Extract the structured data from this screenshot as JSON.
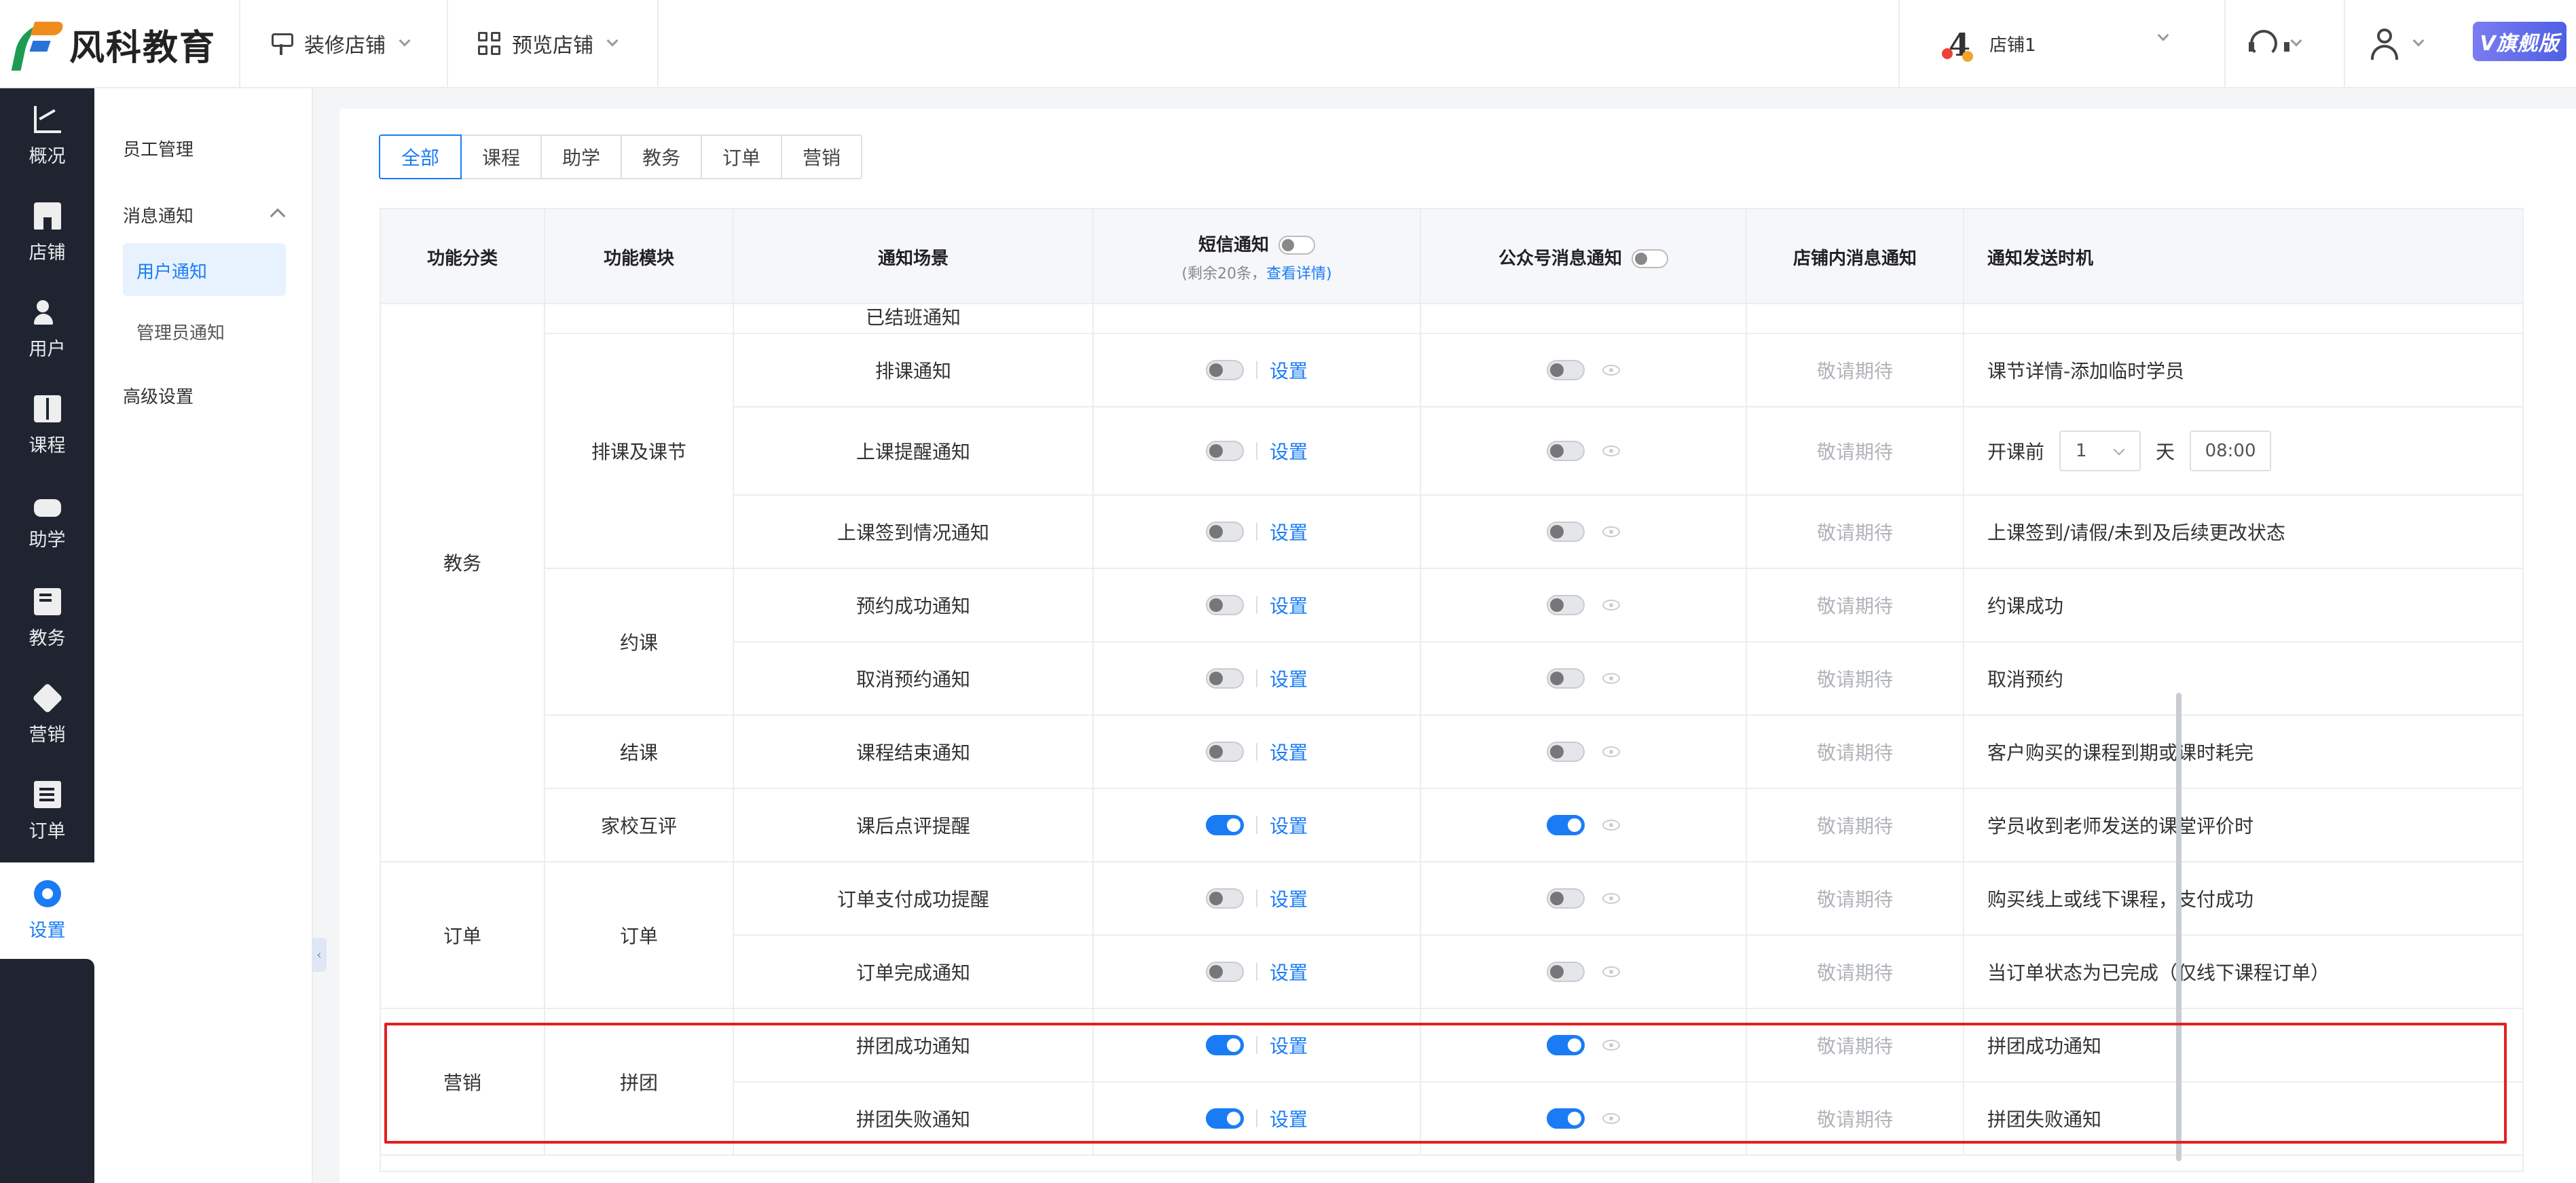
{
  "brand": {
    "name": "风科教育"
  },
  "topnav": {
    "decorate": "装修店铺",
    "preview": "预览店铺"
  },
  "store": {
    "avatar_char": "4",
    "name": "店铺1"
  },
  "badge": {
    "label": "V旗舰版"
  },
  "sidebar": {
    "items": [
      {
        "label": "概况",
        "icon": "chart-icon"
      },
      {
        "label": "店铺",
        "icon": "shop-icon"
      },
      {
        "label": "用户",
        "icon": "users-icon"
      },
      {
        "label": "课程",
        "icon": "book-icon"
      },
      {
        "label": "助学",
        "icon": "gamepad-icon"
      },
      {
        "label": "教务",
        "icon": "edu-icon"
      },
      {
        "label": "营销",
        "icon": "tag-icon"
      },
      {
        "label": "订单",
        "icon": "order-icon"
      },
      {
        "label": "设置",
        "icon": "gear-icon",
        "active": true
      }
    ]
  },
  "submenu": {
    "staff": "员工管理",
    "message": "消息通知",
    "user_notice": "用户通知",
    "admin_notice": "管理员通知",
    "advanced": "高级设置"
  },
  "tabs": [
    "全部",
    "课程",
    "助学",
    "教务",
    "订单",
    "营销"
  ],
  "table": {
    "headers": {
      "category": "功能分类",
      "module": "功能模块",
      "scene": "通知场景",
      "sms": "短信通知",
      "sms_sub": "(剩余20条，",
      "sms_link": "查看详情)",
      "wechat": "公众号消息通知",
      "instore": "店铺内消息通知",
      "timing": "通知发送时机"
    },
    "partial_row": {
      "scene": "已结班通知",
      "link": "设置"
    },
    "categories": {
      "edu": "教务",
      "order": "订单",
      "marketing": "营销"
    },
    "modules": {
      "schedule": "排课及课节",
      "booking": "约课",
      "finish": "结课",
      "review": "家校互评",
      "order": "订单",
      "group": "拼团"
    },
    "setting_link": "设置",
    "pending": "敬请期待",
    "timing_prefix": "开课前",
    "timing_day_value": "1",
    "timing_unit": "天",
    "timing_time": "08:00",
    "rows": [
      {
        "scene": "排课通知",
        "sms_on": false,
        "wx_on": false,
        "timing": "课节详情-添加临时学员"
      },
      {
        "scene": "上课提醒通知",
        "sms_on": false,
        "wx_on": false,
        "timing": ""
      },
      {
        "scene": "上课签到情况通知",
        "sms_on": false,
        "wx_on": false,
        "timing": "上课签到/请假/未到及后续更改状态"
      },
      {
        "scene": "预约成功通知",
        "sms_on": false,
        "wx_on": false,
        "timing": "约课成功"
      },
      {
        "scene": "取消预约通知",
        "sms_on": false,
        "wx_on": false,
        "timing": "取消预约"
      },
      {
        "scene": "课程结束通知",
        "sms_on": false,
        "wx_on": false,
        "timing": "客户购买的课程到期或课时耗完"
      },
      {
        "scene": "课后点评提醒",
        "sms_on": true,
        "wx_on": true,
        "timing": "学员收到老师发送的课堂评价时"
      },
      {
        "scene": "订单支付成功提醒",
        "sms_on": false,
        "wx_on": false,
        "timing": "购买线上或线下课程，支付成功"
      },
      {
        "scene": "订单完成通知",
        "sms_on": false,
        "wx_on": false,
        "timing": "当订单状态为已完成（仅线下课程订单）"
      },
      {
        "scene": "拼团成功通知",
        "sms_on": true,
        "wx_on": true,
        "timing": "拼团成功通知"
      },
      {
        "scene": "拼团失败通知",
        "sms_on": true,
        "wx_on": true,
        "timing": "拼团失败通知"
      }
    ]
  },
  "colors": {
    "accent": "#1a7cf5",
    "sidebar_bg": "#1f2430",
    "highlight": "#e02020"
  }
}
